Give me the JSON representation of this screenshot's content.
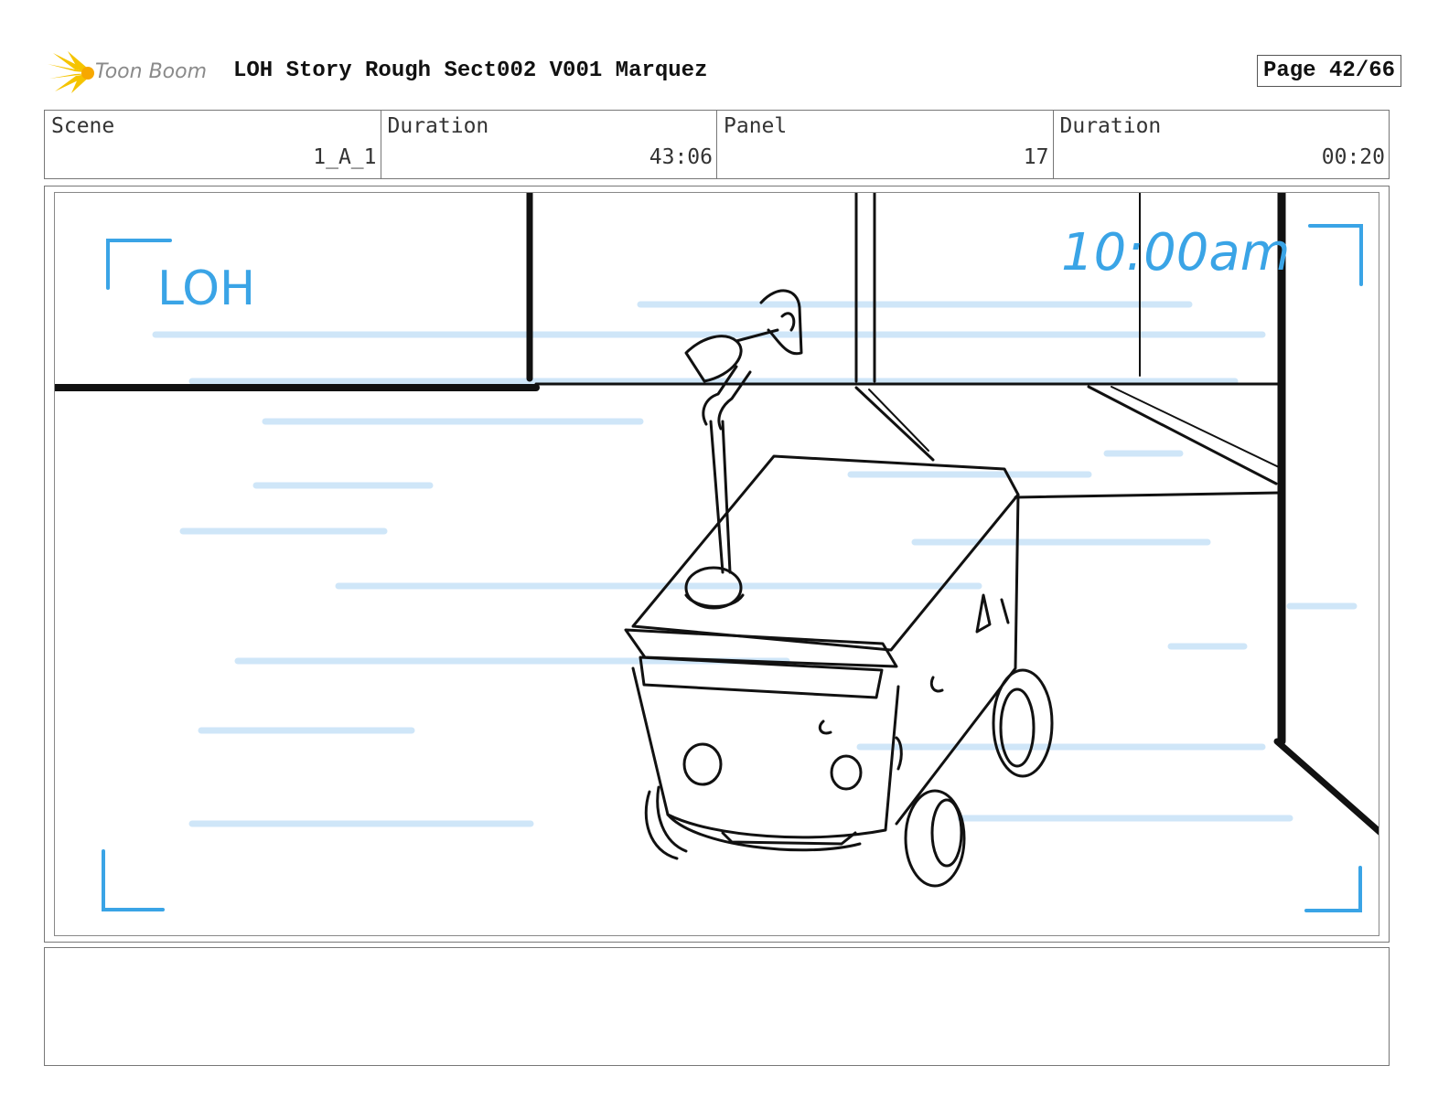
{
  "header": {
    "logo_text": "Toon Boom",
    "title": "LOH Story Rough Sect002 V001 Marquez",
    "page_label": "Page 42/66"
  },
  "info": {
    "scene_label": "Scene",
    "scene_value": "1_A_1",
    "scene_duration_label": "Duration",
    "scene_duration_value": "43:06",
    "panel_label": "Panel",
    "panel_value": "17",
    "panel_duration_label": "Duration",
    "panel_duration_value": "00:20"
  },
  "panel": {
    "sketch_caption_left": "LOH",
    "sketch_caption_right": "10:00am",
    "sketch_subject": "robot-cart sketch"
  },
  "colors": {
    "sketch_blue": "#3aa4e6",
    "sketch_blue_light": "#cfe6f8",
    "ink": "#111111",
    "logo_yellow": "#f5c400"
  }
}
